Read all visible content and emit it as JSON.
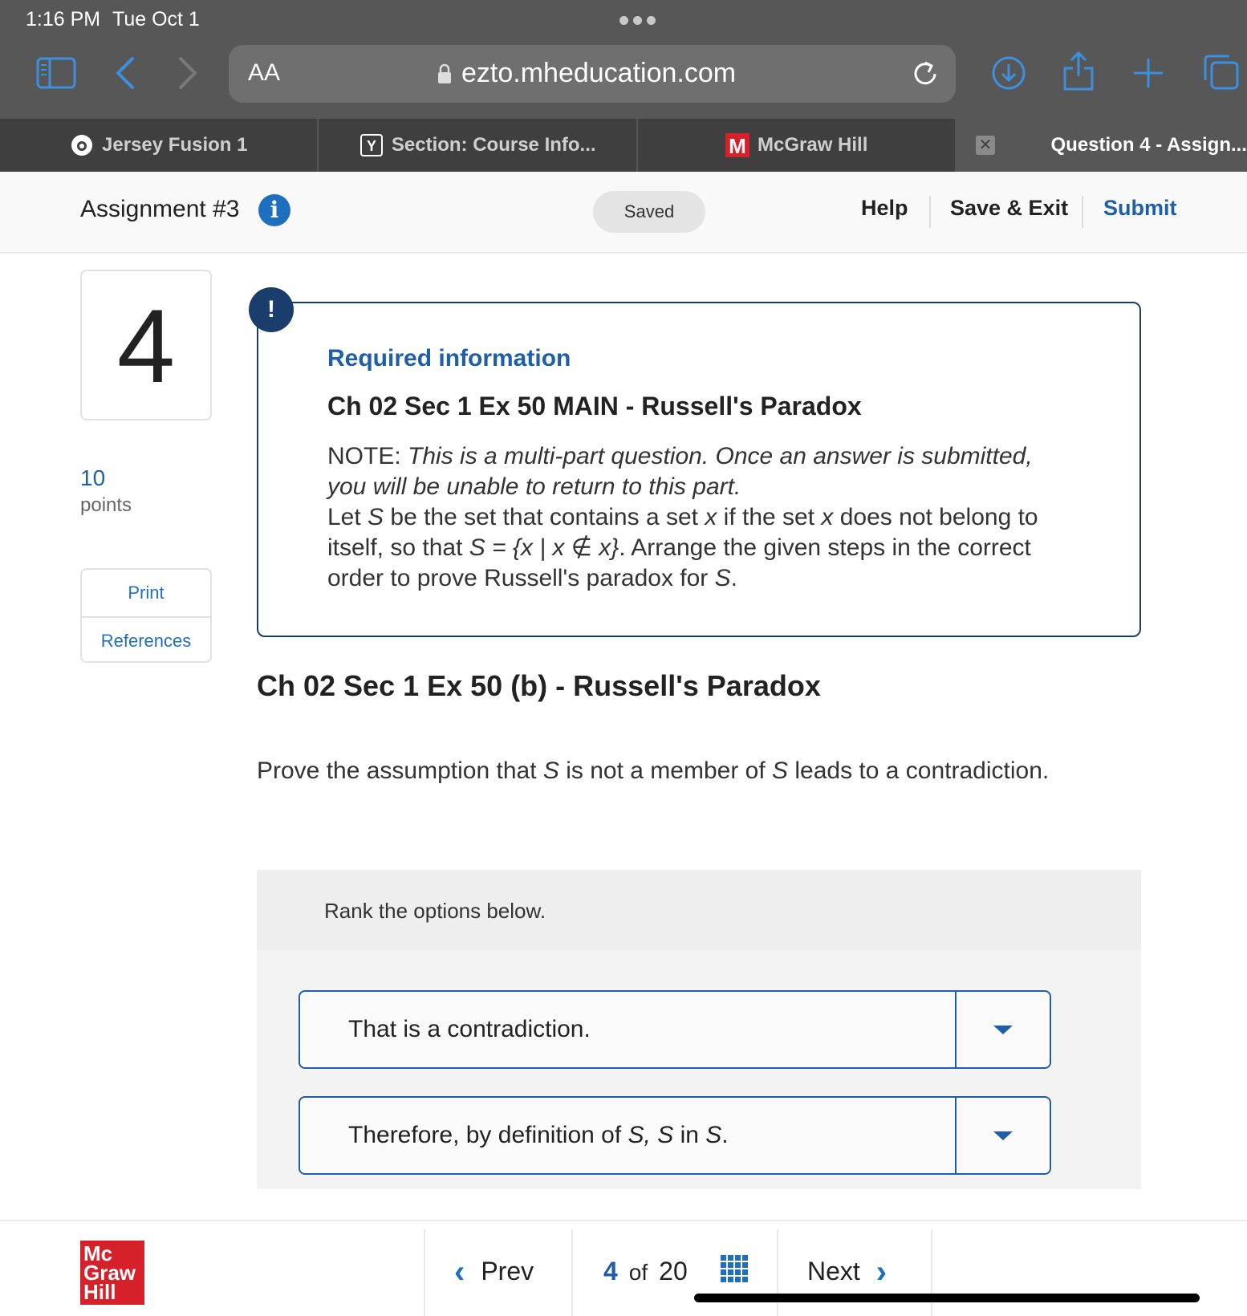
{
  "status_bar": {
    "time": "1:16 PM",
    "date": "Tue Oct 1"
  },
  "browser": {
    "aa_label": "AA",
    "url": "ezto.mheducation.com",
    "tabs": [
      {
        "label": "Jersey Fusion 1",
        "icon": "camera-icon"
      },
      {
        "label": "Section: Course Info...",
        "icon": "y-icon"
      },
      {
        "label": "McGraw Hill",
        "icon": "mcgraw-m-icon"
      },
      {
        "label": "Question 4 - Assign...",
        "icon": "close-icon"
      }
    ]
  },
  "header": {
    "title": "Assignment #3",
    "saved_status": "Saved",
    "help_label": "Help",
    "save_exit_label": "Save & Exit",
    "submit_label": "Submit"
  },
  "question": {
    "number": "4",
    "points_value": "10",
    "points_label": "points",
    "print_label": "Print",
    "references_label": "References"
  },
  "required_info": {
    "badge": "!",
    "title": "Required information",
    "subtitle": "Ch 02 Sec 1 Ex 50 MAIN - Russell's Paradox",
    "note_label": "NOTE:",
    "note_text": "This is a multi-part question. Once an answer is submitted, you will be unable to return to this part.",
    "body_p1": "Let ",
    "body_s1": "S",
    "body_p2": " be the set that contains a set ",
    "body_x1": "x",
    "body_p3": " if the set ",
    "body_x2": "x",
    "body_p4": " does not belong to itself, so that ",
    "body_formula": "S = {x | x ∉ x}",
    "body_p5": ". Arrange the given steps in the correct order to prove Russell's paradox for ",
    "body_s2": "S",
    "body_p6": "."
  },
  "part": {
    "heading": "Ch 02 Sec 1 Ex 50 (b) - Russell's Paradox",
    "prompt_p1": "Prove the assumption that ",
    "prompt_s1": "S",
    "prompt_p2": " is not a member of ",
    "prompt_s2": "S",
    "prompt_p3": " leads to a contradiction."
  },
  "ranking": {
    "instruction": "Rank the options below.",
    "items": [
      {
        "text": "That is a contradiction."
      },
      {
        "p1": "Therefore, by definition of ",
        "s1": "S, S",
        "p2": " in ",
        "s2": "S",
        "p3": "."
      }
    ]
  },
  "footer": {
    "logo_lines": [
      "Mc",
      "Graw",
      "Hill"
    ],
    "prev_label": "Prev",
    "next_label": "Next",
    "current_page": "4",
    "of_label": "of",
    "total_pages": "20"
  },
  "colors": {
    "accent_blue": "#1f5fa8",
    "card_border": "#1a3d6b",
    "brand_red": "#d6202a",
    "browser_chrome": "#575757"
  }
}
